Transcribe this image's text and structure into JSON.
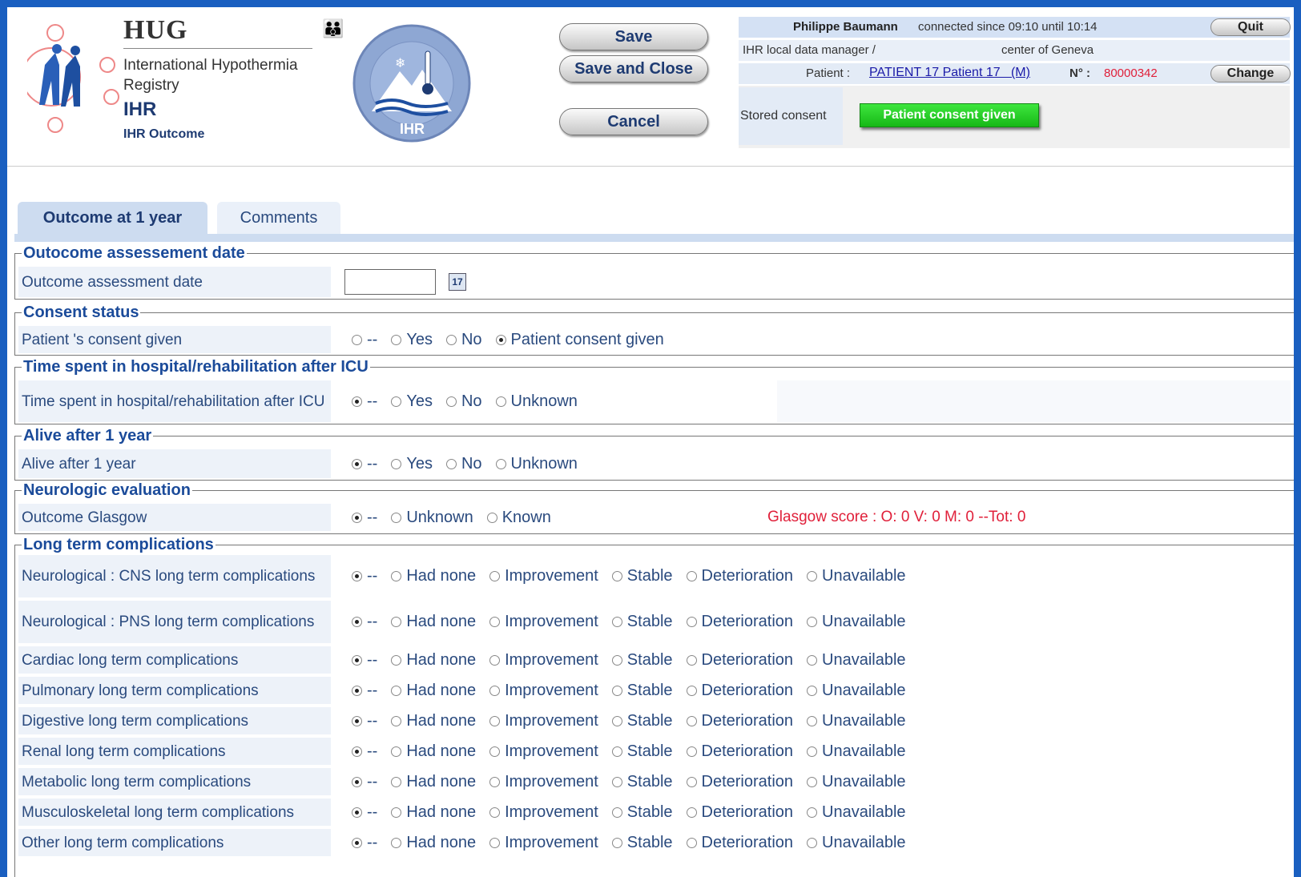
{
  "header": {
    "org_title": "HUG",
    "org_lines": [
      "International Hypothermia",
      "Registry"
    ],
    "app": "IHR",
    "page": "IHR Outcome",
    "badge_text": "IHR",
    "save": "Save",
    "save_close": "Save and Close",
    "cancel": "Cancel",
    "user_name": "Philippe Baumann",
    "connected": "connected since 09:10 until 10:14",
    "quit": "Quit",
    "role": "IHR local data manager /",
    "center": "center of Geneva",
    "patient_label": "Patient :",
    "patient_link": "PATIENT 17 Patient 17   (M)",
    "no_label": "N° :",
    "no_value": "80000342",
    "change": "Change",
    "stored_consent_label": "Stored consent",
    "consent_button": "Patient consent given"
  },
  "tabs": [
    "Outcome at 1 year",
    "Comments"
  ],
  "sections": {
    "date": "Outocome assessement date",
    "consent": "Consent status",
    "time": "Time spent in hospital/rehabilitation after ICU",
    "alive": "Alive after 1 year",
    "neuro": "Neurologic evaluation",
    "long": "Long term complications"
  },
  "rows": {
    "date": "Outcome assessment date",
    "consent": "Patient 's consent given",
    "time": "Time spent in hospital/rehabilitation after ICU",
    "alive": "Alive after 1 year",
    "glasgow": "Outcome Glasgow"
  },
  "date_value": "",
  "options": {
    "consent": [
      "--",
      "Yes",
      "No",
      "Patient consent given"
    ],
    "ynu": [
      "--",
      "Yes",
      "No",
      "Unknown"
    ],
    "glasgow": [
      "--",
      "Unknown",
      "Known"
    ],
    "comp": [
      "--",
      "Had none",
      "Improvement",
      "Stable",
      "Deterioration",
      "Unavailable"
    ]
  },
  "glasgow_score": "Glasgow score : O: 0 V: 0 M: 0 --Tot: 0",
  "complications": [
    "Neurological : CNS long term complications",
    "Neurological : PNS long term complications",
    "Cardiac long term complications",
    "Pulmonary long term complications",
    "Digestive long term complications",
    "Renal long term complications",
    "Metabolic long term complications",
    "Musculoskeletal long term complications",
    "Other long term complications"
  ],
  "colors": {
    "link": "#1a1aa8",
    "red": "#e0203a",
    "green": "#22cc22",
    "label_text": "#2a4a7e",
    "section_text": "#1b4b9a"
  }
}
